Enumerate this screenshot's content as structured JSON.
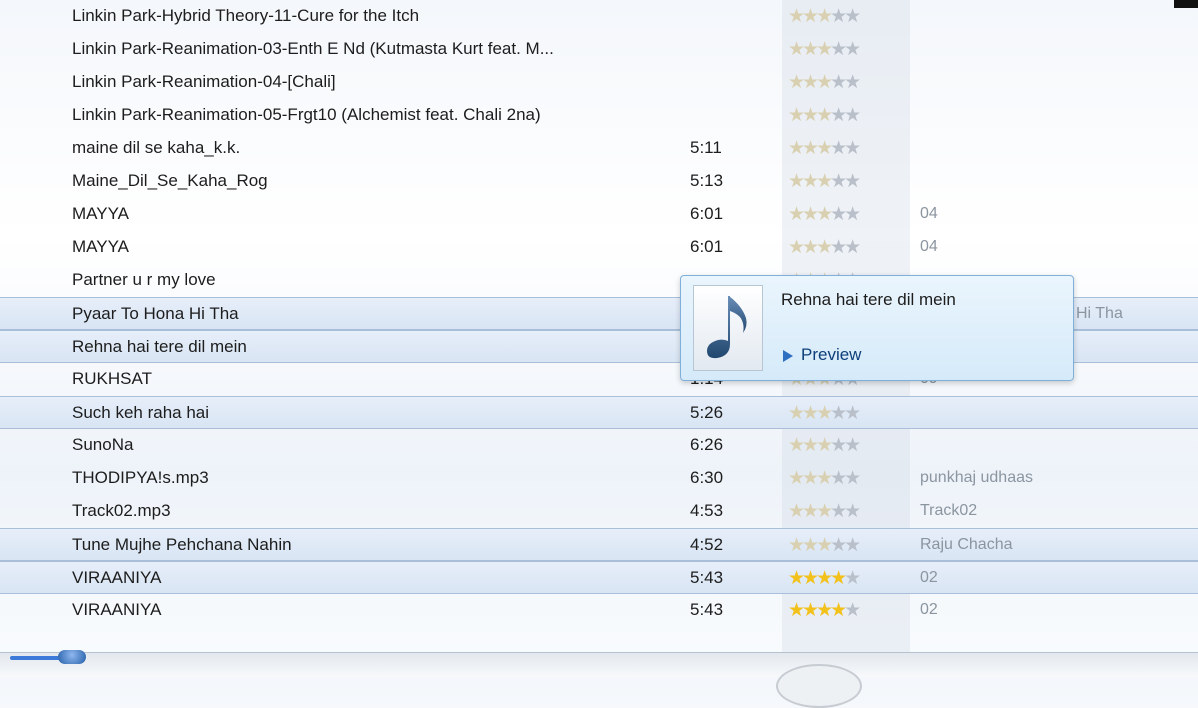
{
  "rows": [
    {
      "title": "Linkin Park-Hybrid Theory-11-Cure for the Itch",
      "length": "",
      "rating": 3,
      "extra": ""
    },
    {
      "title": "Linkin Park-Reanimation-03-Enth E Nd (Kutmasta Kurt feat. M...",
      "length": "",
      "rating": 3,
      "extra": ""
    },
    {
      "title": "Linkin Park-Reanimation-04-[Chali]",
      "length": "",
      "rating": 3,
      "extra": ""
    },
    {
      "title": "Linkin Park-Reanimation-05-Frgt10 (Alchemist feat. Chali 2na)",
      "length": "",
      "rating": 3,
      "extra": ""
    },
    {
      "title": "maine dil se kaha_k.k.",
      "length": "5:11",
      "rating": 3,
      "extra": ""
    },
    {
      "title": "Maine_Dil_Se_Kaha_Rog",
      "length": "5:13",
      "rating": 3,
      "extra": ""
    },
    {
      "title": "MAYYA",
      "length": "6:01",
      "rating": 3,
      "extra": "04"
    },
    {
      "title": "MAYYA",
      "length": "6:01",
      "rating": 3,
      "extra": "04"
    },
    {
      "title": "Partner u r my love",
      "length": "",
      "rating": 3,
      "extra": ""
    },
    {
      "title": "Pyaar To Hona Hi Tha",
      "length": "",
      "rating": 3,
      "extra": "Hi Tha",
      "selected": true
    },
    {
      "title": "Rehna hai tere dil mein",
      "length": "",
      "rating": 3,
      "extra": "",
      "selected": true
    },
    {
      "title": "RUKHSAT",
      "length": "1:14",
      "rating": 3,
      "extra": "09"
    },
    {
      "title": "Such keh raha hai",
      "length": "5:26",
      "rating": 3,
      "extra": "",
      "selected": true
    },
    {
      "title": "SunoNa",
      "length": "6:26",
      "rating": 3,
      "extra": ""
    },
    {
      "title": "THODIPYA!s.mp3",
      "length": "6:30",
      "rating": 3,
      "extra": "punkhaj udhaas"
    },
    {
      "title": "Track02.mp3",
      "length": "4:53",
      "rating": 3,
      "extra": "Track02"
    },
    {
      "title": "Tune Mujhe Pehchana Nahin",
      "length": "4:52",
      "rating": 3,
      "extra": "Raju Chacha",
      "selected": true
    },
    {
      "title": "VIRAANIYA",
      "length": "5:43",
      "rating": 4,
      "extra": "02",
      "gold": true,
      "selected": true
    },
    {
      "title": "VIRAANIYA",
      "length": "5:43",
      "rating": 4,
      "extra": "02",
      "gold": true
    }
  ],
  "popup": {
    "title": "Rehna hai tere dil mein",
    "preview_label": "Preview",
    "art_icon": "music-note-icon"
  },
  "colors": {
    "selected_row": "#dbe6f4",
    "star_gold": "#f2c11c",
    "popup_border": "#7fb0dc"
  }
}
